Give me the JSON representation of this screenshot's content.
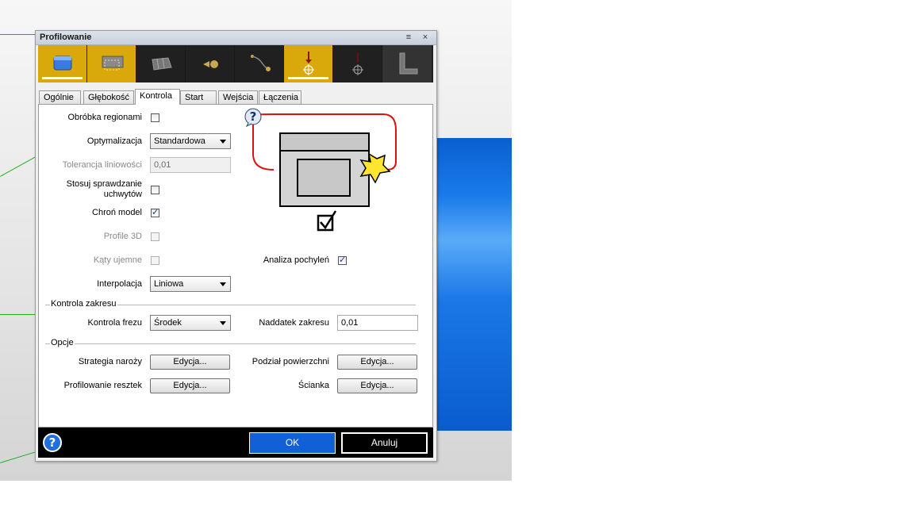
{
  "window": {
    "title": "Profilowanie",
    "menu_icon": "menu-icon",
    "close_label": "×"
  },
  "toolbar": {
    "tools": [
      {
        "icon": "profile-block-icon",
        "state": "active"
      },
      {
        "icon": "boundary-icon",
        "state": "selected"
      },
      {
        "icon": "surface-icon",
        "state": "normal"
      },
      {
        "icon": "tool-icon",
        "state": "normal"
      },
      {
        "icon": "link-path-icon",
        "state": "normal"
      },
      {
        "icon": "start-point-icon",
        "state": "active"
      },
      {
        "icon": "end-point-icon",
        "state": "normal"
      },
      {
        "icon": "corner-icon",
        "state": "normal"
      }
    ]
  },
  "tabs": [
    {
      "label": "Ogólnie"
    },
    {
      "label": "Głębokość"
    },
    {
      "label": "Kontrola",
      "active": true
    },
    {
      "label": "Start"
    },
    {
      "label": "Wejścia"
    },
    {
      "label": "Łączenia"
    }
  ],
  "form": {
    "regions_label": "Obróbka regionami",
    "regions_checked": false,
    "optimization_label": "Optymalizacja",
    "optimization_value": "Standardowa",
    "linearity_label": "Tolerancja liniowości",
    "linearity_value": "0,01",
    "holders_label_line1": "Stosuj sprawdzanie",
    "holders_label_line2": "uchwytów",
    "holders_checked": false,
    "protect_label": "Chroń model",
    "protect_checked": true,
    "profile3d_label": "Profile 3D",
    "profile3d_checked": false,
    "negative_label": "Kąty ujemne",
    "negative_checked": false,
    "slope_label": "Analiza pochyleń",
    "slope_checked": true,
    "interp_label": "Interpolacja",
    "interp_value": "Liniowa"
  },
  "range_group": {
    "title": "Kontrola zakresu",
    "cutter_label": "Kontrola frezu",
    "cutter_value": "Środek",
    "allowance_label": "Naddatek zakresu",
    "allowance_value": "0,01"
  },
  "options_group": {
    "title": "Opcje",
    "corner_label": "Strategia naroży",
    "corner_button": "Edycja...",
    "surface_label": "Podział powierzchni",
    "surface_button": "Edycja...",
    "rest_label": "Profilowanie resztek",
    "rest_button": "Edycja...",
    "wall_label": "Ścianka",
    "wall_button": "Edycja..."
  },
  "preview": {
    "help_icon": "help-bubble-icon",
    "check_icon": "checkbox-checked-icon"
  },
  "footer": {
    "ok_label": "OK",
    "cancel_label": "Anuluj",
    "help_icon": "help-circle-icon"
  },
  "colors": {
    "accent_yellow": "#d9a90b",
    "ok_blue": "#1160d6",
    "guide_green": "#1db31d",
    "preview_red": "#e01010"
  }
}
